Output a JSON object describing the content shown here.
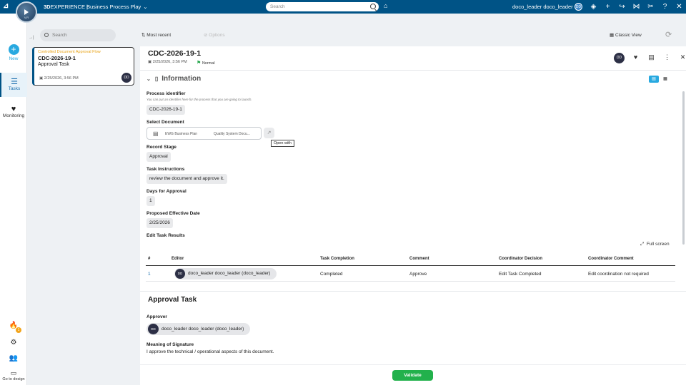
{
  "topbar": {
    "brand_prefix": "3D",
    "brand_suffix": "EXPERIENCE",
    "separator": "|",
    "app_name": "Business Process Play",
    "compass_version": "V,R",
    "search_placeholder": "Search",
    "user_name": "doco_leader doco_leader",
    "user_initials": "DD",
    "accent": "#005386"
  },
  "rail": {
    "new_label": "New",
    "tasks_label": "Tasks",
    "monitoring_label": "Monitoring",
    "notif_count": "1",
    "go_design_label": "Go to design"
  },
  "toolbar": {
    "search_placeholder": "Search",
    "sort_label": "Most recent",
    "options_label": "Options",
    "classic_view_label": "Classic View"
  },
  "task_card": {
    "kicker": "Controlled Document Approval Flow",
    "id": "CDC-2026-19-1",
    "type": "Approval Task",
    "date": "2/25/2026, 3:56 PM",
    "avatar": "DD"
  },
  "detail": {
    "title": "CDC-2026-19-1",
    "date": "2/25/2026, 3:56 PM",
    "priority": "Normal",
    "avatar": "DD",
    "section_info": "Information",
    "process_identifier_label": "Process identifier",
    "process_identifier_hint": "You can put an identifier here for the process that you are going to launch.",
    "process_identifier_value": "CDC-2026-19-1",
    "select_document_label": "Select Document",
    "document_name": "EWG Business Plan",
    "document_title": "Quality System Docu...",
    "open_with_tooltip": "Open with",
    "record_stage_label": "Record Stage",
    "record_stage_value": "Approval",
    "task_instructions_label": "Task Instructions",
    "task_instructions_value": "review the document and approve it.",
    "days_label": "Days for Approval",
    "days_value": "1",
    "effective_date_label": "Proposed Effective Date",
    "effective_date_value": "2/25/2026",
    "edit_task_results_label": "Edit Task Results",
    "full_screen_label": "Full screen",
    "table": {
      "headers": [
        "#",
        "Editor",
        "Task Completion",
        "Comment",
        "Coordinator Decision",
        "Coordinator Comment"
      ],
      "rows": [
        {
          "num": "1",
          "editor_initials": "DD",
          "editor": "doco_leader doco_leader (doco_leader)",
          "completion": "Completed",
          "comment": "Approve",
          "decision": "Edit Task Completed",
          "coord_comment": "Edit coordination not required"
        }
      ]
    },
    "section_approval": "Approval Task",
    "approver_label": "Approver",
    "approver_initials": "DD",
    "approver_name": "doco_leader doco_leader (doco_leader)",
    "meaning_label": "Meaning of Signature",
    "meaning_value": "I approve the technical / operational aspects of this document.",
    "validate_label": "Validate"
  }
}
